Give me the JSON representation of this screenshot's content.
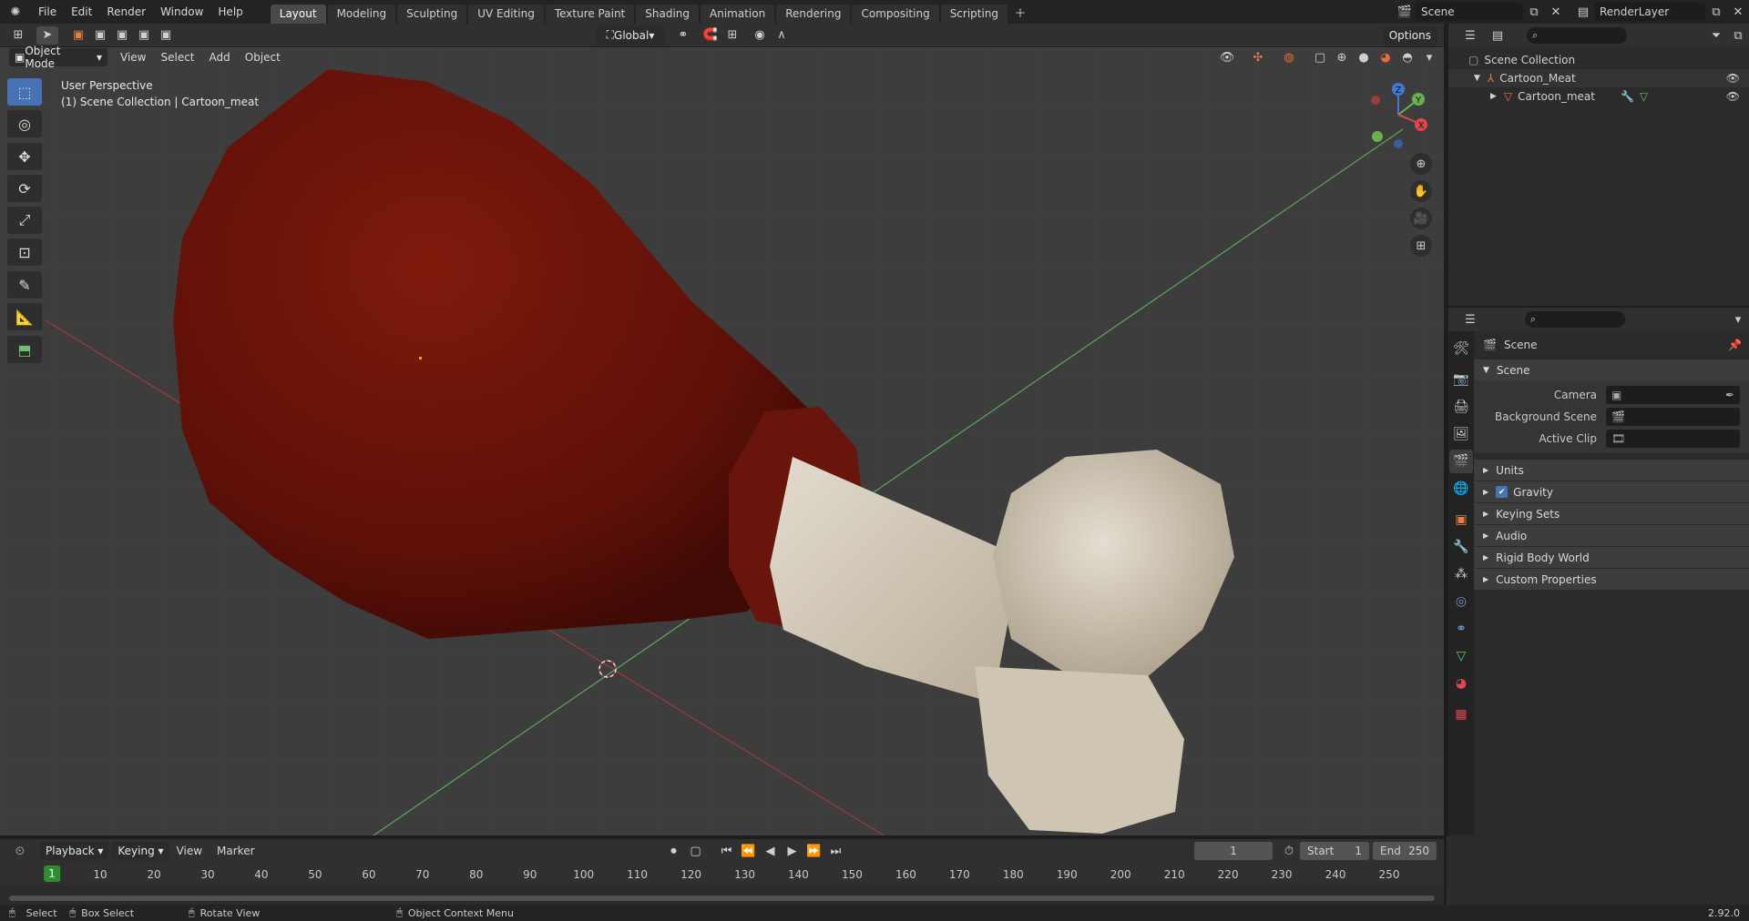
{
  "menu": {
    "file": "File",
    "edit": "Edit",
    "render": "Render",
    "window": "Window",
    "help": "Help"
  },
  "workspaces": [
    "Layout",
    "Modeling",
    "Sculpting",
    "UV Editing",
    "Texture Paint",
    "Shading",
    "Animation",
    "Rendering",
    "Compositing",
    "Scripting"
  ],
  "scene_name": "Scene",
  "render_layer": "RenderLayer",
  "viewport_header": {
    "mode": "Object Mode",
    "view": "View",
    "select": "Select",
    "add": "Add",
    "object": "Object",
    "transform": "Global",
    "options": "Options"
  },
  "viewport_overlay": {
    "line1": "User Perspective",
    "line2": "(1) Scene Collection | Cartoon_meat"
  },
  "gizmo": {
    "x": "X",
    "y": "Y",
    "z": "Z"
  },
  "outliner": {
    "root": "Scene Collection",
    "collection": "Cartoon_Meat",
    "object": "Cartoon_meat"
  },
  "properties": {
    "context": "Scene",
    "section": "Scene",
    "camera_label": "Camera",
    "background_label": "Background Scene",
    "clip_label": "Active Clip",
    "panels": [
      "Units",
      "Gravity",
      "Keying Sets",
      "Audio",
      "Rigid Body World",
      "Custom Properties"
    ]
  },
  "timeline": {
    "playback": "Playback",
    "keying": "Keying",
    "view": "View",
    "marker": "Marker",
    "current_frame": "1",
    "start_label": "Start",
    "start": "1",
    "end_label": "End",
    "end": "250",
    "ticks": [
      "1",
      "10",
      "20",
      "30",
      "40",
      "50",
      "60",
      "70",
      "80",
      "90",
      "100",
      "110",
      "120",
      "130",
      "140",
      "150",
      "160",
      "170",
      "180",
      "190",
      "200",
      "210",
      "220",
      "230",
      "240",
      "250"
    ]
  },
  "status": {
    "select": "Select",
    "box_select": "Box Select",
    "rotate_view": "Rotate View",
    "context_menu": "Object Context Menu",
    "version": "2.92.0"
  },
  "colors": {
    "accent": "#4772b3",
    "active_frame": "#2f8d31",
    "meat": "#7a1a0c",
    "bone": "#d9d1c3"
  }
}
